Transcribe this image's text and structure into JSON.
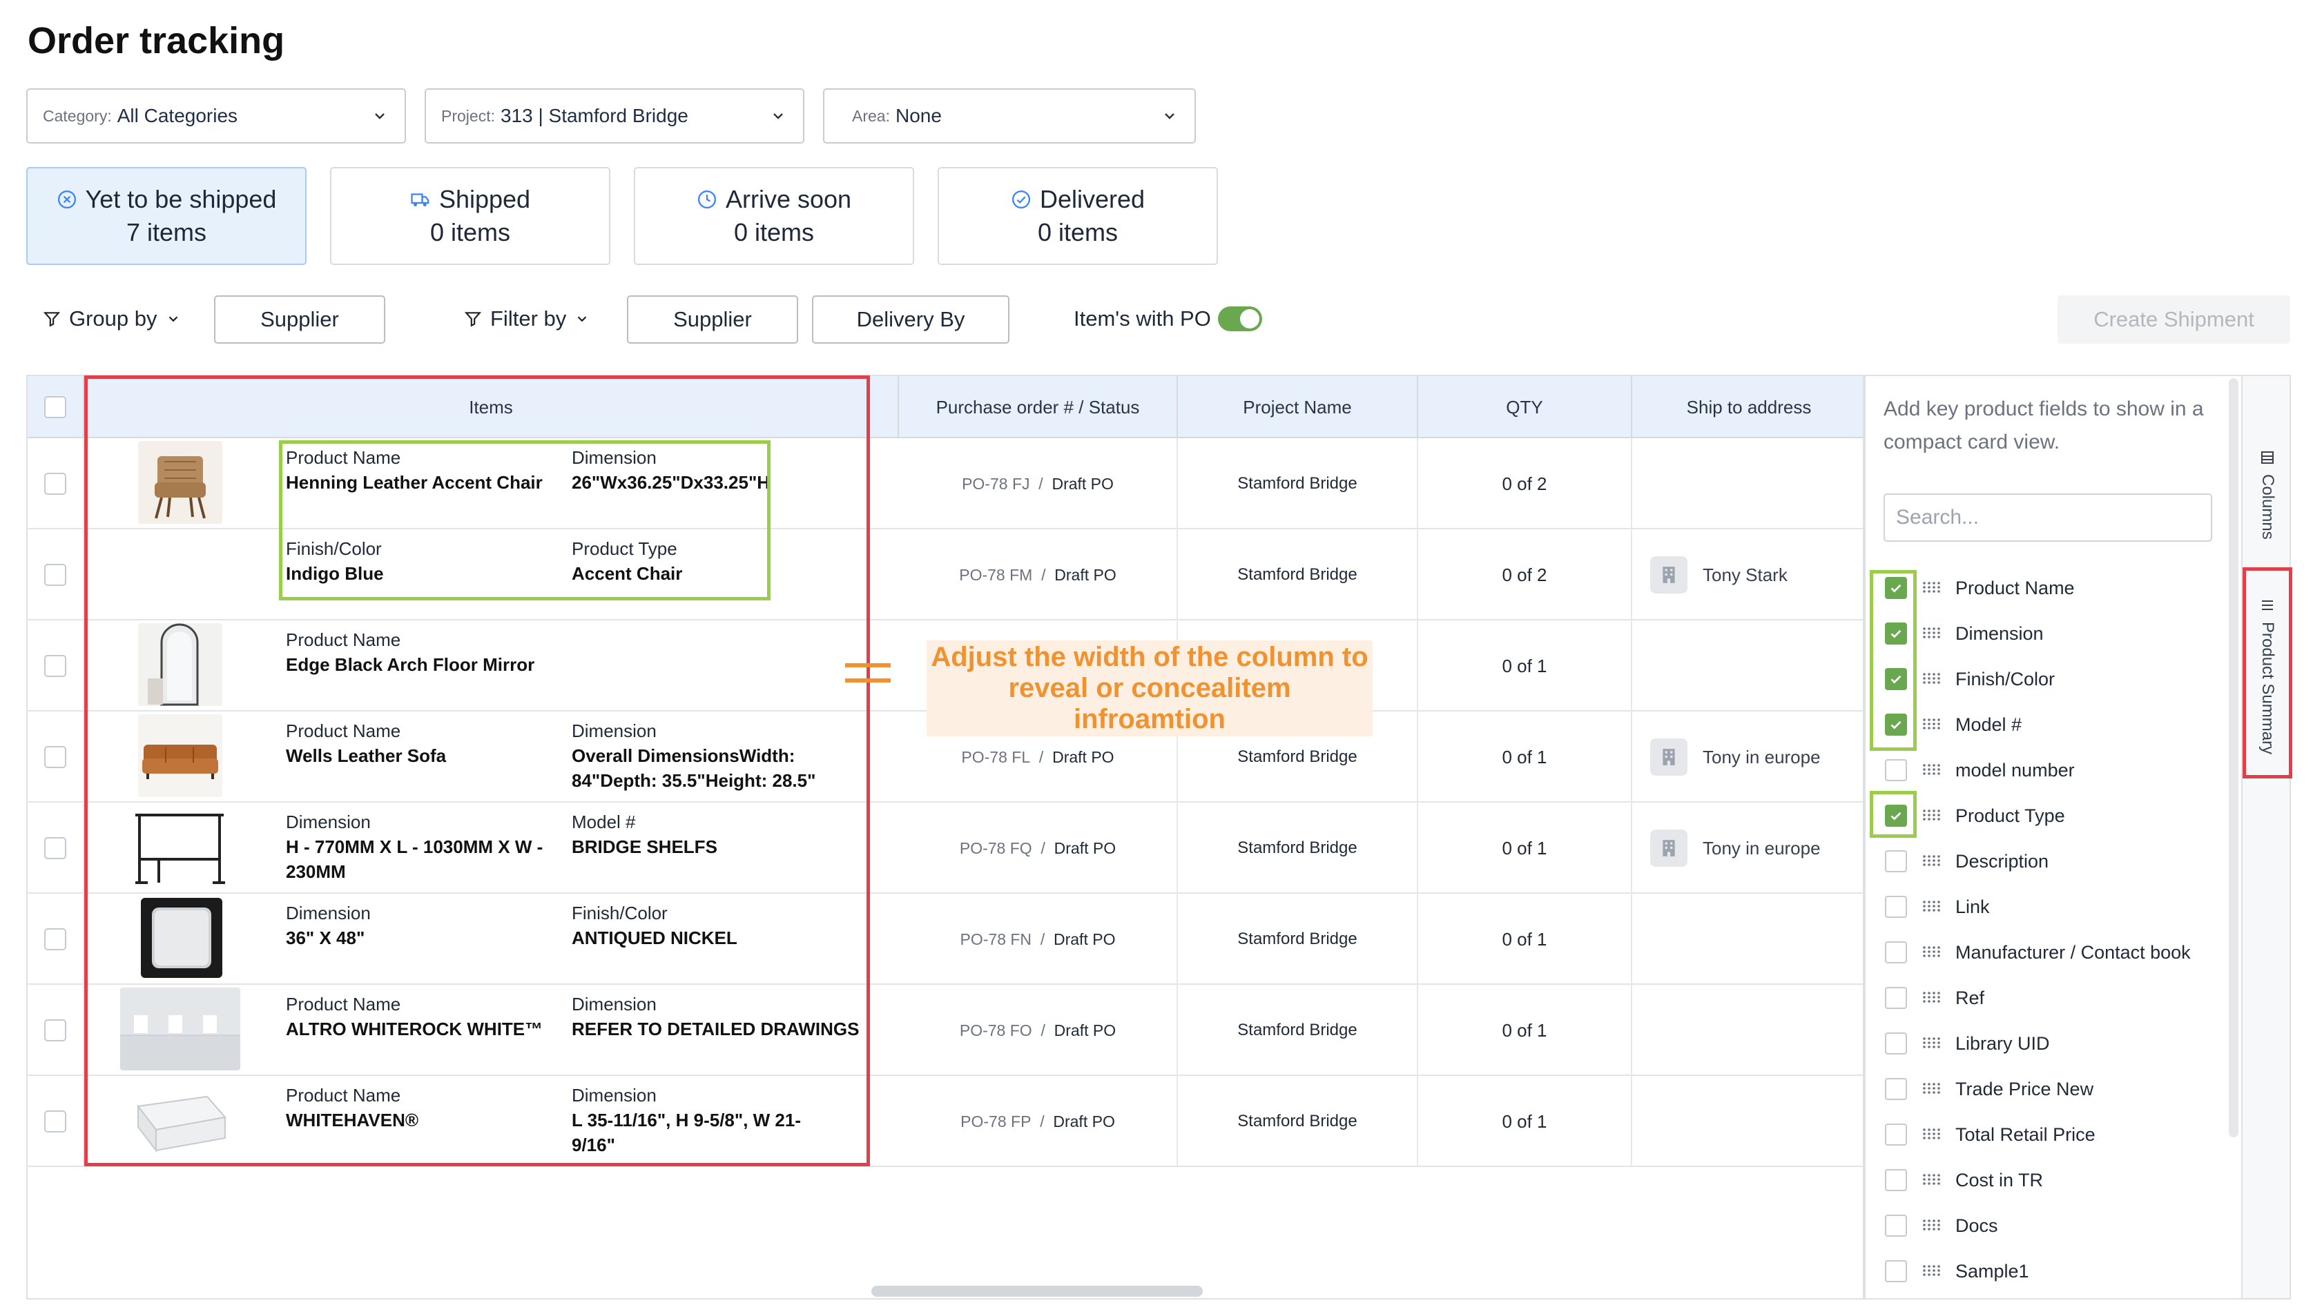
{
  "page": {
    "title": "Order tracking"
  },
  "filters": [
    {
      "label": "Category:",
      "value": "All Categories"
    },
    {
      "label": "Project:",
      "value": "313 | Stamford Bridge"
    },
    {
      "label": "Area:",
      "value": "None"
    }
  ],
  "status_cards": [
    {
      "title": "Yet to be shipped",
      "count": "7 items",
      "icon": "x-circle-icon",
      "active": true
    },
    {
      "title": "Shipped",
      "count": "0 items",
      "icon": "truck-icon",
      "active": false
    },
    {
      "title": "Arrive soon",
      "count": "0 items",
      "icon": "clock-icon",
      "active": false
    },
    {
      "title": "Delivered",
      "count": "0 items",
      "icon": "check-circle-icon",
      "active": false
    }
  ],
  "toolbar": {
    "group_by": "Group by",
    "group_supplier": "Supplier",
    "filter_by": "Filter by",
    "filter_supplier": "Supplier",
    "delivery_by": "Delivery By",
    "po_toggle_label": "Item's with PO",
    "po_toggle_on": true,
    "create_shipment": "Create Shipment"
  },
  "table": {
    "headers": [
      "Items",
      "Purchase order # / Status",
      "Project Name",
      "QTY",
      "Ship to address"
    ],
    "rows": [
      {
        "f1_label": "Product Name",
        "f1_value": "Henning Leather Accent Chair",
        "f2_label": "Dimension",
        "f2_value": "26\"Wx36.25\"Dx33.25\"H",
        "po": "PO-78 FJ",
        "status": "Draft PO",
        "project": "Stamford Bridge",
        "qty": "0 of 2",
        "address": ""
      },
      {
        "f1_label": "Finish/Color",
        "f1_value": "Indigo Blue",
        "f2_label": "Product Type",
        "f2_value": "Accent Chair",
        "po": "PO-78 FM",
        "status": "Draft PO",
        "project": "Stamford Bridge",
        "qty": "0 of 2",
        "address": "Tony Stark"
      },
      {
        "f1_label": "Product Name",
        "f1_value": "Edge Black Arch Floor Mirror",
        "f2_label": "",
        "f2_value": "",
        "po": "",
        "status": "",
        "project": "",
        "qty": "0 of 1",
        "address": ""
      },
      {
        "f1_label": "Product Name",
        "f1_value": "Wells Leather Sofa",
        "f2_label": "Dimension",
        "f2_value": "Overall DimensionsWidth: 84\"Depth: 35.5\"Height: 28.5\"",
        "po": "PO-78 FL",
        "status": "Draft PO",
        "project": "Stamford Bridge",
        "qty": "0 of 1",
        "address": "Tony in europe"
      },
      {
        "f1_label": "Dimension",
        "f1_value": "H - 770MM X L - 1030MM X W - 230MM",
        "f2_label": "Model #",
        "f2_value": "BRIDGE SHELFS",
        "po": "PO-78 FQ",
        "status": "Draft PO",
        "project": "Stamford Bridge",
        "qty": "0 of 1",
        "address": "Tony in europe"
      },
      {
        "f1_label": "Dimension",
        "f1_value": "36\" X 48\"",
        "f2_label": "Finish/Color",
        "f2_value": "ANTIQUED NICKEL",
        "po": "PO-78 FN",
        "status": "Draft PO",
        "project": "Stamford Bridge",
        "qty": "0 of 1",
        "address": ""
      },
      {
        "f1_label": "Product Name",
        "f1_value": "ALTRO WHITEROCK WHITE™",
        "f2_label": "Dimension",
        "f2_value": "REFER TO DETAILED DRAWINGS",
        "po": "PO-78 FO",
        "status": "Draft PO",
        "project": "Stamford Bridge",
        "qty": "0 of 1",
        "address": ""
      },
      {
        "f1_label": "Product Name",
        "f1_value": "WHITEHAVEN®",
        "f2_label": "Dimension",
        "f2_value": "L 35-11/16\", H 9-5/8\", W 21-9/16\"",
        "po": "PO-78 FP",
        "status": "Draft PO",
        "project": "Stamford Bridge",
        "qty": "0 of 1",
        "address": ""
      }
    ]
  },
  "annotation": {
    "text": "Adjust the width of the column to reveal or concealitem infroamtion",
    "color": "#f0922f"
  },
  "panel": {
    "help": "Add key product fields to show in a compact card view.",
    "search_placeholder": "Search...",
    "fields": [
      {
        "label": "Product Name",
        "checked": true
      },
      {
        "label": "Dimension",
        "checked": true
      },
      {
        "label": "Finish/Color",
        "checked": true
      },
      {
        "label": "Model #",
        "checked": true
      },
      {
        "label": "model number",
        "checked": false
      },
      {
        "label": "Product Type",
        "checked": true
      },
      {
        "label": "Description",
        "checked": false
      },
      {
        "label": "Link",
        "checked": false
      },
      {
        "label": "Manufacturer / Contact book",
        "checked": false
      },
      {
        "label": "Ref",
        "checked": false
      },
      {
        "label": "Library UID",
        "checked": false
      },
      {
        "label": "Trade Price New",
        "checked": false
      },
      {
        "label": "Total Retail Price",
        "checked": false
      },
      {
        "label": "Cost in TR",
        "checked": false
      },
      {
        "label": "Docs",
        "checked": false
      },
      {
        "label": "Sample1",
        "checked": false
      }
    ]
  },
  "side_tabs": {
    "columns": "Columns",
    "product_summary": "Product Summary"
  },
  "colors": {
    "accent_green": "#6aa84f",
    "highlight_red": "#e0404a",
    "highlight_green": "#9acd4a",
    "active_card": "#e6f1fc"
  }
}
